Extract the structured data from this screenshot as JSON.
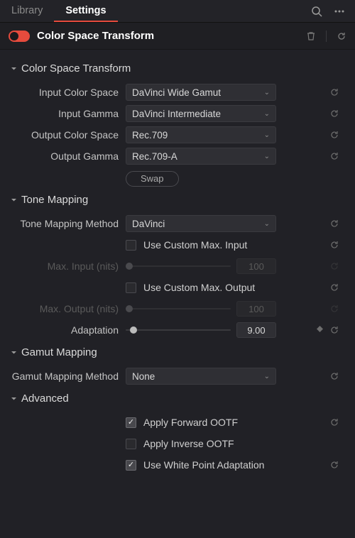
{
  "tabs": {
    "library": "Library",
    "settings": "Settings"
  },
  "effect": {
    "title": "Color Space Transform"
  },
  "sections": {
    "cst": {
      "title": "Color Space Transform",
      "input_color_space": {
        "label": "Input Color Space",
        "value": "DaVinci Wide Gamut"
      },
      "input_gamma": {
        "label": "Input Gamma",
        "value": "DaVinci Intermediate"
      },
      "output_color_space": {
        "label": "Output Color Space",
        "value": "Rec.709"
      },
      "output_gamma": {
        "label": "Output Gamma",
        "value": "Rec.709-A"
      },
      "swap": "Swap"
    },
    "tone": {
      "title": "Tone Mapping",
      "method": {
        "label": "Tone Mapping Method",
        "value": "DaVinci"
      },
      "use_custom_max_input": "Use Custom Max. Input",
      "max_input": {
        "label": "Max. Input (nits)",
        "value": "100"
      },
      "use_custom_max_output": "Use Custom Max. Output",
      "max_output": {
        "label": "Max. Output (nits)",
        "value": "100"
      },
      "adaptation": {
        "label": "Adaptation",
        "value": "9.00"
      }
    },
    "gamut": {
      "title": "Gamut Mapping",
      "method": {
        "label": "Gamut Mapping Method",
        "value": "None"
      }
    },
    "advanced": {
      "title": "Advanced",
      "apply_forward_ootf": "Apply Forward OOTF",
      "apply_inverse_ootf": "Apply Inverse OOTF",
      "use_white_point": "Use White Point Adaptation"
    }
  }
}
